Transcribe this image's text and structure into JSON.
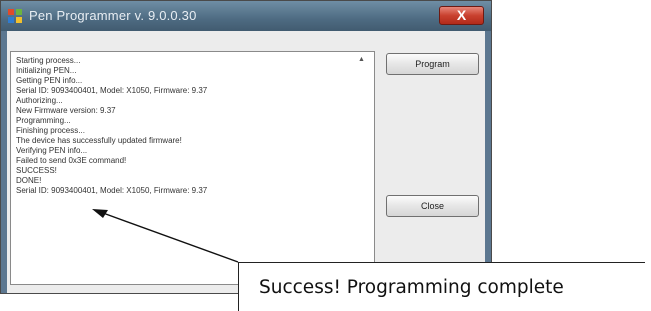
{
  "window": {
    "title": "Pen Programmer v. 9.0.0.30",
    "close_glyph": "X"
  },
  "log": {
    "lines": [
      "Starting process...",
      "Initializing PEN...",
      "Getting PEN info...",
      "Serial ID: 9093400401, Model: X1050, Firmware: 9.37",
      "Authorizing...",
      "New Firmware version: 9.37",
      "Programming...",
      "Finishing process...",
      "The device has successfully updated firmware!",
      "Verifying PEN info...",
      "Failed to send 0x3E command!",
      "SUCCESS!",
      "DONE!",
      "Serial ID: 9093400401, Model: X1050, Firmware: 9.37"
    ],
    "scroll_up_glyph": "▲"
  },
  "buttons": {
    "program_label": "Program",
    "close_label": "Close"
  },
  "callout": {
    "text": "Success! Programming complete"
  },
  "icons": {
    "app_icon": "app-icon",
    "close_icon": "close-icon",
    "arrow": "arrow-annotation"
  },
  "colors": {
    "titlebar": "#4e6b82",
    "close_button": "#c9412f",
    "window_bg": "#ececec"
  }
}
